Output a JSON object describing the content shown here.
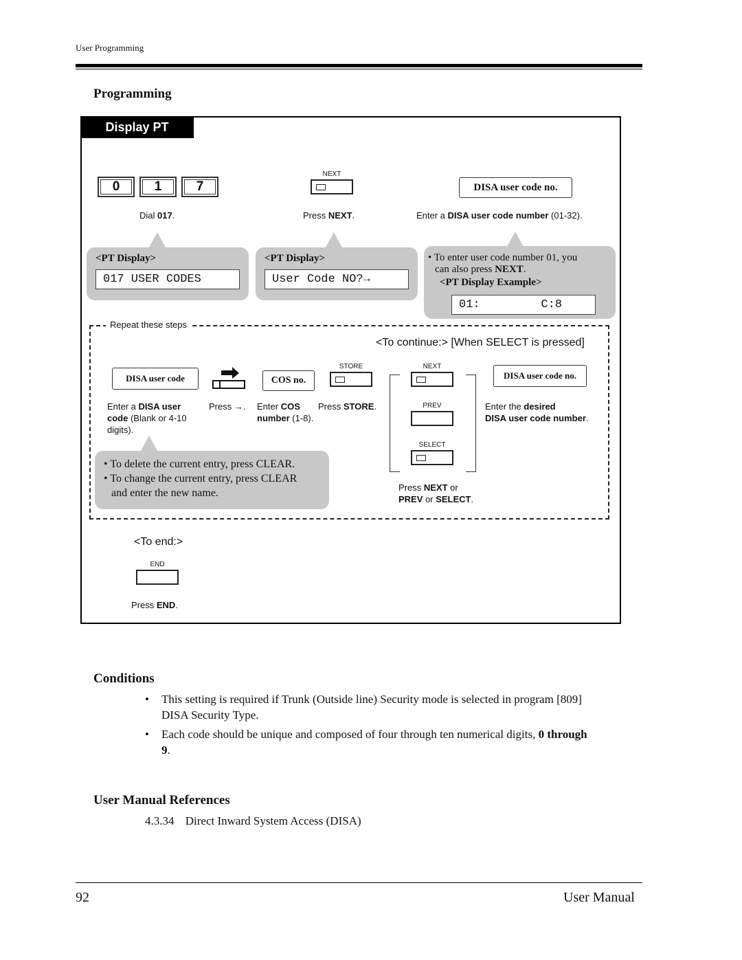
{
  "header": {
    "running_head": "User Programming"
  },
  "programming": {
    "heading": "Programming",
    "tab_label": "Display PT",
    "step1": {
      "digits": [
        "0",
        "1",
        "7"
      ],
      "caption_pre": "Dial ",
      "caption_bold": "017",
      "caption_post": ".",
      "bubble_title": "<PT Display>",
      "lcd": "017 USER CODES"
    },
    "step2": {
      "key_label": "NEXT",
      "caption_pre": "Press ",
      "caption_bold": "NEXT",
      "caption_post": ".",
      "bubble_title": "<PT Display>",
      "lcd": "User Code NO?→"
    },
    "step3": {
      "entry_label": "DISA user code no.",
      "caption_pre": "Enter a ",
      "caption_bold": "DISA user code number",
      "caption_post": " (01-32).",
      "bubble_note_line1": "To enter user code number 01, you",
      "bubble_note_line2_pre": "can also press ",
      "bubble_note_line2_bold": "NEXT",
      "bubble_note_line2_post": ".",
      "bubble_example_title": "<PT Display Example>",
      "lcd_left": "01:",
      "lcd_right": "C:8"
    },
    "repeat": {
      "label": "Repeat these steps",
      "continue_label": "<To continue:> [When SELECT is pressed]",
      "entry_disa_code": "DISA user code",
      "caption_disa_code_pre": "Enter a ",
      "caption_disa_code_bold1": "DISA user",
      "caption_disa_code_bold2": "code",
      "caption_disa_code_post": " (Blank or 4-10",
      "caption_disa_code_line3": "digits).",
      "caption_arrow": "Press →.",
      "entry_cos": "COS no.",
      "caption_cos_pre": "Enter ",
      "caption_cos_bold1": "COS",
      "caption_cos_bold2": "number",
      "caption_cos_post": " (1-8).",
      "store_key_label": "STORE",
      "caption_store_pre": "Press ",
      "caption_store_bold": "STORE",
      "caption_store_post": ".",
      "next_key_label": "NEXT",
      "prev_key_label": "PREV",
      "select_key_label": "SELECT",
      "caption_nav_pre": "Press ",
      "caption_nav_bold1": "NEXT",
      "caption_nav_mid1": " or",
      "caption_nav_bold2": "PREV",
      "caption_nav_mid2": " or ",
      "caption_nav_bold3": "SELECT",
      "caption_nav_post": ".",
      "entry_desired": "DISA user code no.",
      "caption_desired_pre": "Enter the ",
      "caption_desired_bold1": "desired",
      "caption_desired_bold2": "DISA user code number",
      "caption_desired_post": ".",
      "notes": [
        "To delete the current entry, press CLEAR.",
        "To change the current entry, press CLEAR",
        "and enter the new name."
      ]
    },
    "end": {
      "label": "<To end:>",
      "key_label": "END",
      "caption_pre": "Press ",
      "caption_bold": "END",
      "caption_post": "."
    }
  },
  "conditions": {
    "heading": "Conditions",
    "items": [
      {
        "line1": "This setting is required if Trunk (Outside line) Security mode is selected in program [809]",
        "line2": "DISA Security Type."
      },
      {
        "line1_pre": "Each code should be unique and composed of four through ten numerical digits, ",
        "line1_bold": "0 through",
        "line2_bold": "9",
        "line2_post": "."
      }
    ]
  },
  "references": {
    "heading": "User Manual References",
    "items": [
      {
        "number": "4.3.34",
        "title": "Direct Inward System Access (DISA)"
      }
    ]
  },
  "footer": {
    "page_number": "92",
    "manual_title": "User Manual"
  }
}
